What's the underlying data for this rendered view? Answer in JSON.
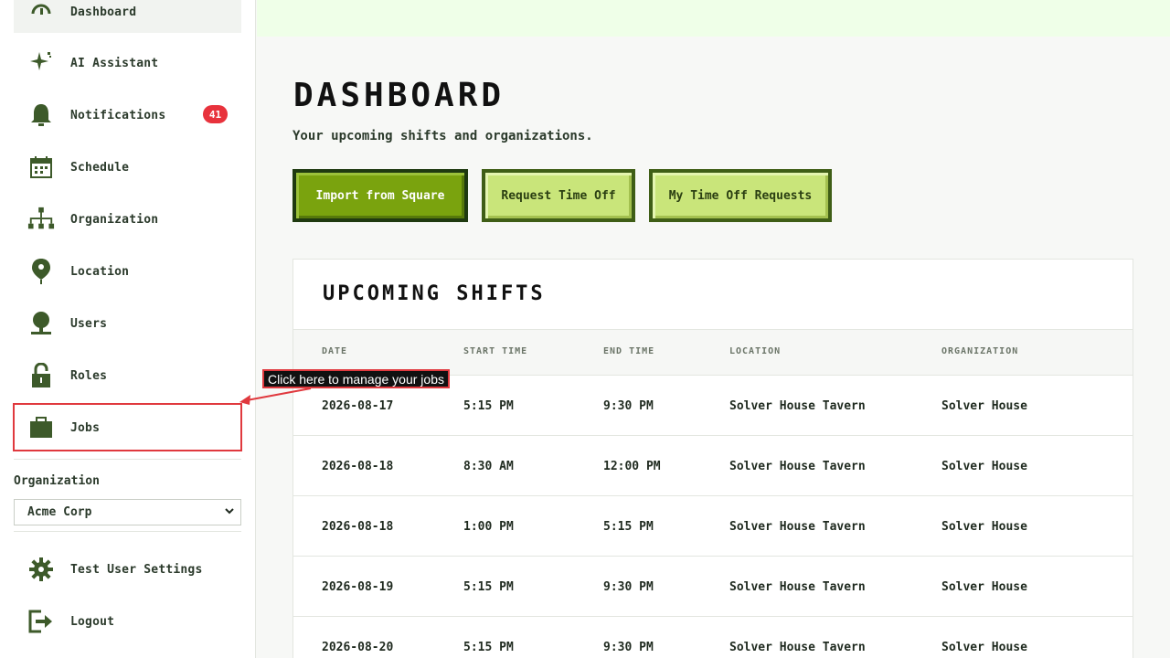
{
  "sidebar": {
    "items": [
      {
        "label": "Dashboard",
        "icon": "dashboard-icon",
        "active": true
      },
      {
        "label": "AI Assistant",
        "icon": "sparkle-icon"
      },
      {
        "label": "Notifications",
        "icon": "bell-icon",
        "badge": "41"
      },
      {
        "label": "Schedule",
        "icon": "calendar-icon"
      },
      {
        "label": "Organization",
        "icon": "org-chart-icon"
      },
      {
        "label": "Location",
        "icon": "map-pin-icon"
      },
      {
        "label": "Users",
        "icon": "user-icon"
      },
      {
        "label": "Roles",
        "icon": "lock-icon"
      },
      {
        "label": "Jobs",
        "icon": "briefcase-icon"
      }
    ],
    "org_label": "Organization",
    "org_selected": "Acme Corp",
    "bottom_items": [
      {
        "label": "Test User Settings",
        "icon": "gear-icon"
      },
      {
        "label": "Logout",
        "icon": "logout-icon"
      }
    ]
  },
  "main": {
    "title": "DASHBOARD",
    "subtitle": "Your upcoming shifts and organizations.",
    "buttons": {
      "import": "Import from Square",
      "request_time_off": "Request Time Off",
      "my_requests": "My Time Off Requests"
    },
    "shifts": {
      "title": "UPCOMING SHIFTS",
      "columns": [
        "DATE",
        "START TIME",
        "END TIME",
        "LOCATION",
        "ORGANIZATION"
      ],
      "rows": [
        [
          "2026-08-17",
          "5:15 PM",
          "9:30 PM",
          "Solver House Tavern",
          "Solver House"
        ],
        [
          "2026-08-18",
          "8:30 AM",
          "12:00 PM",
          "Solver House Tavern",
          "Solver House"
        ],
        [
          "2026-08-18",
          "1:00 PM",
          "5:15 PM",
          "Solver House Tavern",
          "Solver House"
        ],
        [
          "2026-08-19",
          "5:15 PM",
          "9:30 PM",
          "Solver House Tavern",
          "Solver House"
        ],
        [
          "2026-08-20",
          "5:15 PM",
          "9:30 PM",
          "Solver House Tavern",
          "Solver House"
        ]
      ]
    }
  },
  "tooltip": {
    "text": "Click here to manage your jobs"
  },
  "colors": {
    "accent": "#7aa30e",
    "accent_dark": "#1f3a10",
    "button_light": "#c9e57a",
    "badge": "#e8323c",
    "highlight": "#e0393e",
    "icon": "#3d5a2a"
  }
}
